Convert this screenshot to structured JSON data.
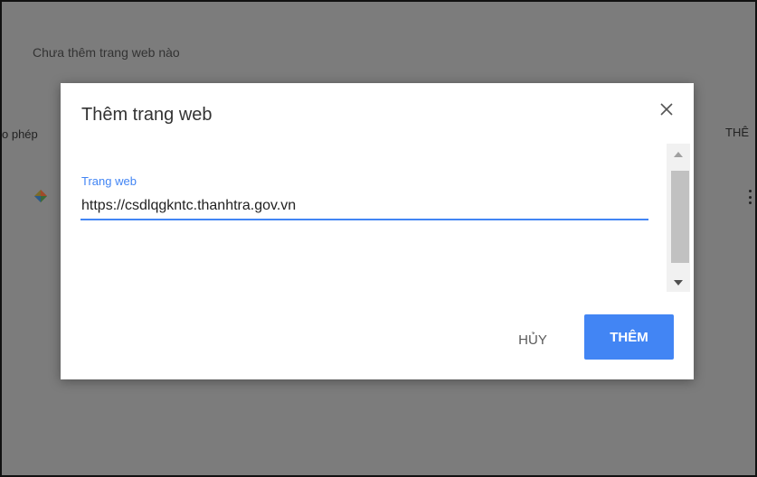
{
  "background": {
    "empty_message": "Chưa thêm trang web nào",
    "left_partial": "o phép",
    "right_partial": "THÊ"
  },
  "dialog": {
    "title": "Thêm trang web",
    "field": {
      "label": "Trang web",
      "value": "https://csdlqgkntc.thanhtra.gov.vn"
    },
    "cancel_label": "HỦY",
    "add_label": "THÊM"
  },
  "colors": {
    "accent": "#4285f4",
    "overlay": "#7c7c7c"
  },
  "icons": [
    "close-icon",
    "scroll-up-icon",
    "scroll-down-icon",
    "site-favicon-icon",
    "more-vert-icon"
  ]
}
